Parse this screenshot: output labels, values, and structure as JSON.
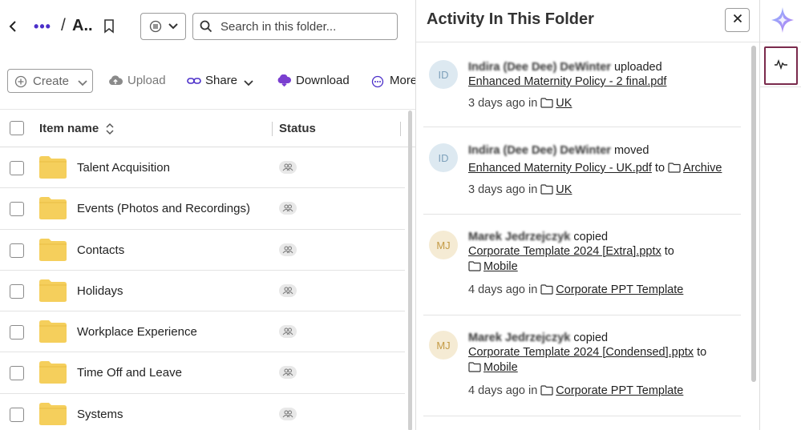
{
  "breadcrumb": {
    "ellipsis": "•••",
    "separator": "/",
    "current": "A.."
  },
  "search": {
    "placeholder": "Search in this folder..."
  },
  "toolbar": {
    "create_label": "Create",
    "upload_label": "Upload",
    "share_label": "Share",
    "download_label": "Download",
    "more_label": "More"
  },
  "table": {
    "columns": {
      "name": "Item name",
      "status": "Status"
    },
    "rows": [
      {
        "name": "Talent Acquisition",
        "type": "folder",
        "status_icon": "shared-users-icon"
      },
      {
        "name": "Events (Photos and Recordings)",
        "type": "folder",
        "status_icon": "shared-users-icon"
      },
      {
        "name": "Contacts",
        "type": "folder",
        "status_icon": "shared-users-icon"
      },
      {
        "name": "Holidays",
        "type": "folder",
        "status_icon": "shared-users-icon"
      },
      {
        "name": "Workplace Experience",
        "type": "folder",
        "status_icon": "shared-users-icon"
      },
      {
        "name": "Time Off and Leave",
        "type": "folder",
        "status_icon": "shared-users-icon"
      },
      {
        "name": "Systems",
        "type": "folder",
        "status_icon": "shared-users-icon"
      }
    ]
  },
  "activity": {
    "title": "Activity In This Folder",
    "items": [
      {
        "initials": "ID",
        "user": "Indira (Dee Dee) DeWinter",
        "action": "uploaded",
        "file": "Enhanced Maternity Policy - 2 final.pdf",
        "time": "3 days ago in",
        "location": "UK"
      },
      {
        "initials": "ID",
        "user": "Indira (Dee Dee) DeWinter",
        "action": "moved",
        "file": "Enhanced Maternity Policy - UK.pdf",
        "to_word": "to",
        "target": "Archive",
        "time": "3 days ago in",
        "location": "UK"
      },
      {
        "initials": "MJ",
        "user": "Marek Jedrzejczyk",
        "action": "copied",
        "file": "Corporate Template 2024 [Extra].pptx",
        "to_word": "to",
        "target": "Mobile",
        "time": "4 days ago in",
        "location": "Corporate PPT Template"
      },
      {
        "initials": "MJ",
        "user": "Marek Jedrzejczyk",
        "action": "copied",
        "file": "Corporate Template 2024 [Condensed].pptx",
        "to_word": "to",
        "target": "Mobile",
        "time": "4 days ago in",
        "location": "Corporate PPT Template"
      }
    ]
  },
  "colors": {
    "accent_purple": "#4b2fc9",
    "folder_yellow": "#f5cf5c",
    "activity_border": "#7a2a4c",
    "avatar_id_bg": "#dde9f1",
    "avatar_mj_bg": "#f5ebd4"
  },
  "icons": {
    "strip_top": "ai-sparkle-icon",
    "strip_activity": "activity-pulse-icon"
  }
}
